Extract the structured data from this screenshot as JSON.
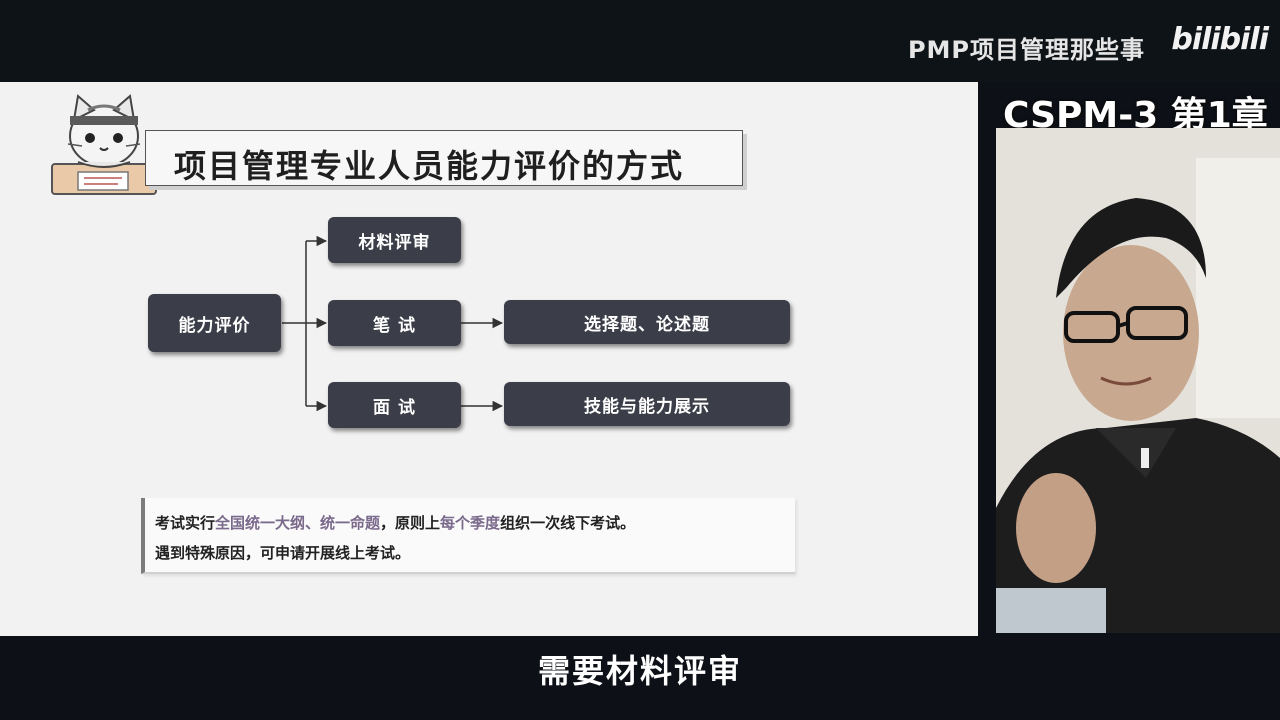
{
  "header": {
    "channel_name": "PMP项目管理那些事",
    "logo_text": "bilibili"
  },
  "slide": {
    "title": "项目管理专业人员能力评价的方式",
    "mascot_icon": "cat-mascot-icon",
    "diagram": {
      "root": "能力评价",
      "branches": [
        "材料评审",
        "笔 试",
        "面 试"
      ],
      "details": [
        "选择题、论述题",
        "技能与能力展示"
      ]
    },
    "note": {
      "line1_parts": [
        "考试实行",
        "全国统一大纲、统一命题",
        "，原则上",
        "每个季度",
        "组织一次线下考试。"
      ],
      "line2": "遇到特殊原因，可申请开展线上考试。"
    }
  },
  "video": {
    "chapter_label": "CSPM-3 第1章"
  },
  "subtitle": "需要材料评审",
  "colors": {
    "node_fill": "#3b3d48",
    "highlight": "#7a6a8c",
    "slide_bg": "#f2f2f2",
    "frame_bg": "#0e1318"
  }
}
